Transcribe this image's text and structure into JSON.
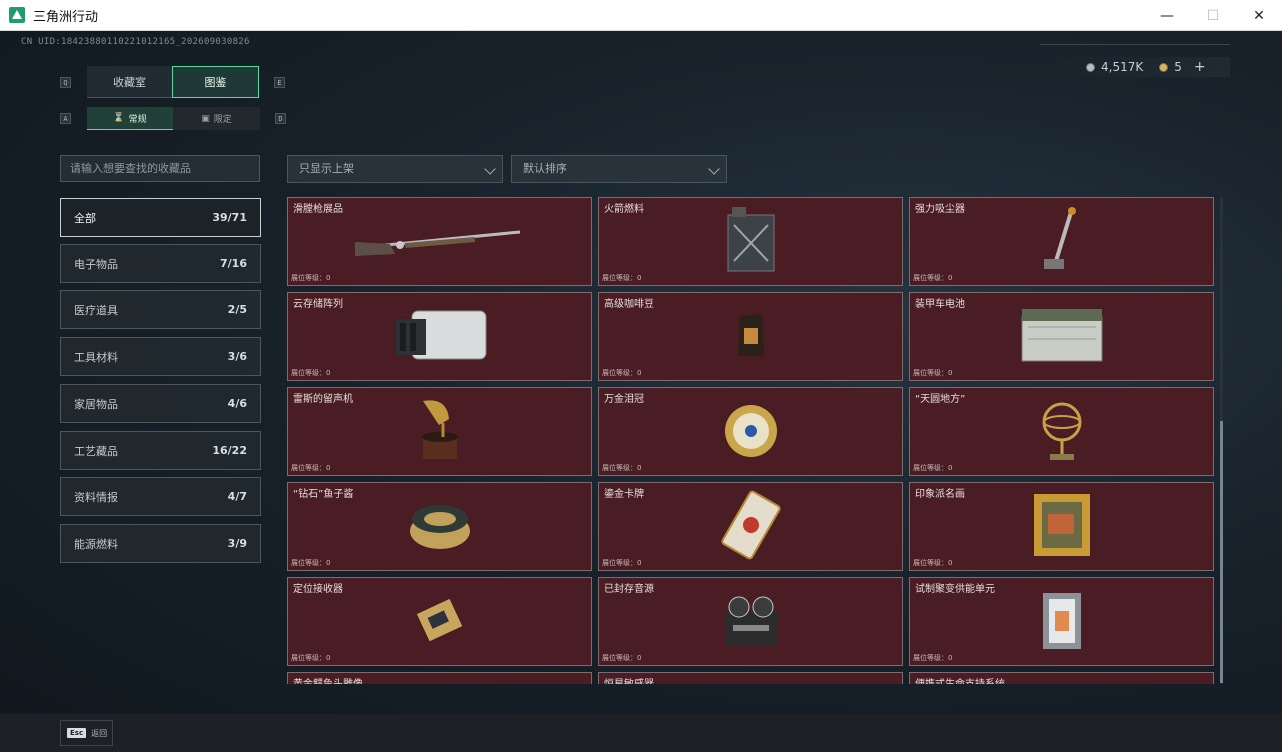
{
  "window": {
    "title": "三角洲行动",
    "minimize": "—",
    "maximize": "☐",
    "close": "✕"
  },
  "header": {
    "uid": "CN UID:18423880110221012165_202609030826",
    "currency_amount": "4,517K",
    "ticket_amount": "5",
    "plus": "+"
  },
  "tabs": {
    "left_key": "Q",
    "right_key": "E",
    "collection_room": "收藏室",
    "catalog": "图鉴",
    "sub_left_key": "A",
    "sub_right_key": "D",
    "normal": "常规",
    "limited": "限定"
  },
  "search": {
    "placeholder": "请输入想要查找的收藏品"
  },
  "filters": {
    "shelf_filter": "只显示上架",
    "sort": "默认排序"
  },
  "categories": [
    {
      "label": "全部",
      "count": "39/71"
    },
    {
      "label": "电子物品",
      "count": "7/16"
    },
    {
      "label": "医疗道具",
      "count": "2/5"
    },
    {
      "label": "工具材料",
      "count": "3/6"
    },
    {
      "label": "家居物品",
      "count": "4/6"
    },
    {
      "label": "工艺藏品",
      "count": "16/22"
    },
    {
      "label": "资料情报",
      "count": "4/7"
    },
    {
      "label": "能源燃料",
      "count": "3/9"
    }
  ],
  "items": [
    {
      "name": "滑膛枪展品",
      "level": "展位等级：0",
      "icon": "musket-icon"
    },
    {
      "name": "火箭燃料",
      "level": "展位等级：0",
      "icon": "fuel-can-icon"
    },
    {
      "name": "强力吸尘器",
      "level": "展位等级：0",
      "icon": "vacuum-icon"
    },
    {
      "name": "云存储阵列",
      "level": "展位等级：0",
      "icon": "storage-array-icon"
    },
    {
      "name": "高级咖啡豆",
      "level": "展位等级：0",
      "icon": "coffee-bag-icon"
    },
    {
      "name": "装甲车电池",
      "level": "展位等级：0",
      "icon": "battery-icon"
    },
    {
      "name": "雷斯的留声机",
      "level": "展位等级：0",
      "icon": "gramophone-icon"
    },
    {
      "name": "万金泪冠",
      "level": "展位等级：0",
      "icon": "jeweled-egg-icon"
    },
    {
      "name": "“天圆地方”",
      "level": "展位等级：0",
      "icon": "armillary-sphere-icon"
    },
    {
      "name": "“钻石”鱼子酱",
      "level": "展位等级：0",
      "icon": "caviar-tin-icon"
    },
    {
      "name": "鎏金卡牌",
      "level": "展位等级：0",
      "icon": "gilded-card-icon"
    },
    {
      "name": "印象派名画",
      "level": "展位等级：0",
      "icon": "painting-icon"
    },
    {
      "name": "定位接收器",
      "level": "展位等级：0",
      "icon": "receiver-icon"
    },
    {
      "name": "已封存音源",
      "level": "展位等级：0",
      "icon": "tape-recorder-icon"
    },
    {
      "name": "试制聚变供能单元",
      "level": "展位等级：0",
      "icon": "fusion-cell-icon"
    },
    {
      "name": "黄金鳄鱼头雕像",
      "level": "",
      "icon": "croc-statue-icon"
    },
    {
      "name": "恒星敏感器",
      "level": "",
      "icon": "star-sensor-icon"
    },
    {
      "name": "便携式生命支持系统",
      "level": "",
      "icon": "life-support-icon"
    }
  ],
  "footer": {
    "esc_key": "Esc",
    "back_label": "返回"
  },
  "colors": {
    "accent": "#5ad69e",
    "card_bg": "#4a1c23"
  }
}
